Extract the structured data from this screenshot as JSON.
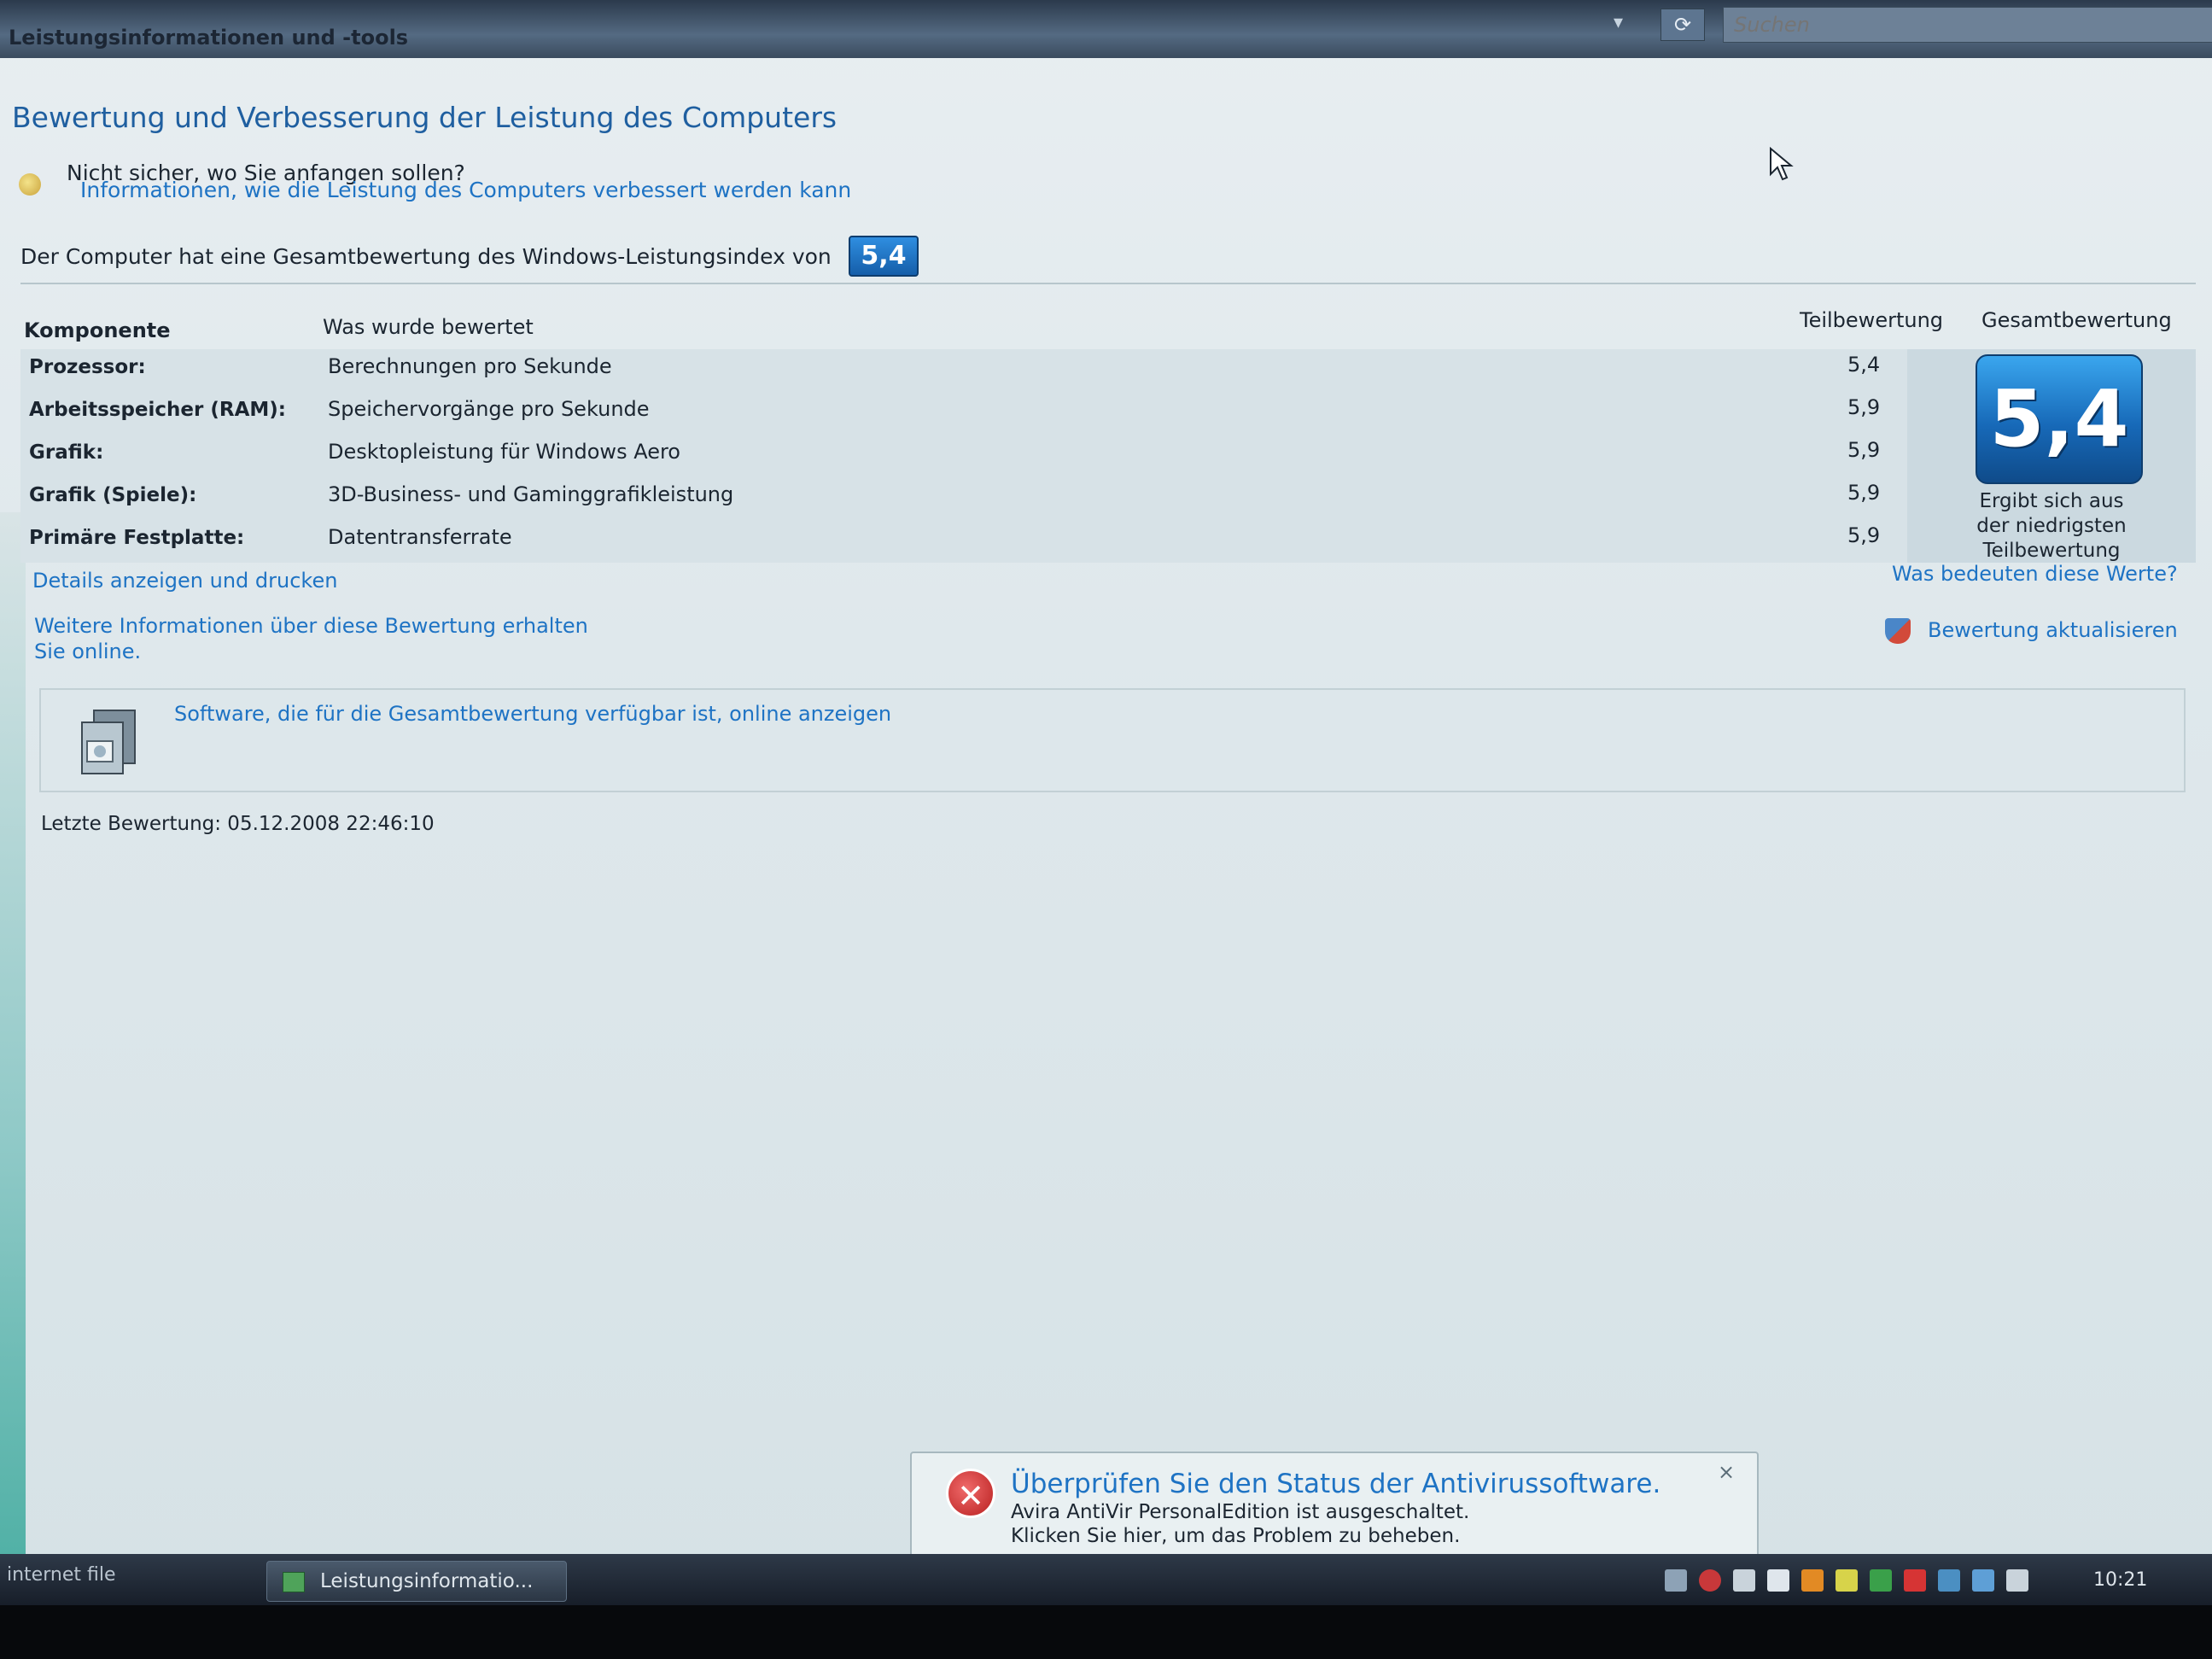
{
  "window": {
    "title": "Leistungsinformationen und -tools",
    "search_placeholder": "Suchen",
    "refresh_glyph": "⟳",
    "dropdown_glyph": "▾"
  },
  "main": {
    "page_title": "Bewertung und Verbesserung der Leistung des Computers",
    "hint_title": "Nicht sicher, wo Sie anfangen sollen?",
    "hint_link": "Informationen, wie die Leistung des Computers verbessert werden kann",
    "overall_text": "Der Computer hat eine Gesamtbewertung des Windows-Leistungsindex von",
    "overall_score": "5,4"
  },
  "table": {
    "headers": {
      "component": "Komponente",
      "what": "Was wurde bewertet",
      "subscore": "Teilbewertung",
      "total": "Gesamtbewertung"
    },
    "rows": [
      {
        "component": "Prozessor:",
        "what": "Berechnungen pro Sekunde",
        "score": "5,4"
      },
      {
        "component": "Arbeitsspeicher (RAM):",
        "what": "Speichervorgänge pro Sekunde",
        "score": "5,9"
      },
      {
        "component": "Grafik:",
        "what": "Desktopleistung für Windows Aero",
        "score": "5,9"
      },
      {
        "component": "Grafik (Spiele):",
        "what": "3D-Business- und Gaminggrafikleistung",
        "score": "5,9"
      },
      {
        "component": "Primäre Festplatte:",
        "what": "Datentransferrate",
        "score": "5,9"
      }
    ],
    "total_score": "5,4",
    "total_caption_1": "Ergibt sich aus",
    "total_caption_2": "der niedrigsten",
    "total_caption_3": "Teilbewertung"
  },
  "links": {
    "details": "Details anzeigen und drucken",
    "meaning": "Was bedeuten diese Werte?",
    "more_info_1": "Weitere Informationen über diese Bewertung erhalten",
    "more_info_2": "Sie online.",
    "update": "Bewertung aktualisieren",
    "software": "Software, die für die Gesamtbewertung verfügbar ist, online anzeigen"
  },
  "last_eval": "Letzte Bewertung: 05.12.2008 22:46:10",
  "balloon": {
    "title": "Überprüfen Sie den Status der Antivirussoftware.",
    "line1": "Avira AntiVir PersonalEdition ist ausgeschaltet.",
    "line2": "Klicken Sie hier, um das Problem zu beheben.",
    "close": "×",
    "icon_glyph": "✕"
  },
  "taskbar": {
    "left_label": "internet file",
    "task_label": "Leistungsinformatio...",
    "clock": "10:21",
    "tray_icons": [
      {
        "name": "chevron-left-icon",
        "color": "#8da2b6"
      },
      {
        "name": "security-center-icon",
        "color": "#c8383a"
      },
      {
        "name": "zone-alarm-icon",
        "color": "#c9d3db"
      },
      {
        "name": "language-bar-icon",
        "color": "#dfe6ec"
      },
      {
        "name": "firewall-icon",
        "color": "#e28a24"
      },
      {
        "name": "network-shield-icon",
        "color": "#d7d34a"
      },
      {
        "name": "update-icon",
        "color": "#3aa04a"
      },
      {
        "name": "antivir-icon",
        "color": "#d63434"
      },
      {
        "name": "device-icon",
        "color": "#4b8fc2"
      },
      {
        "name": "network-icon",
        "color": "#5e9fd6"
      },
      {
        "name": "volume-icon",
        "color": "#c9d3db"
      }
    ]
  },
  "colors": {
    "link": "#1e73c4",
    "score_tile": "#1769b8"
  }
}
